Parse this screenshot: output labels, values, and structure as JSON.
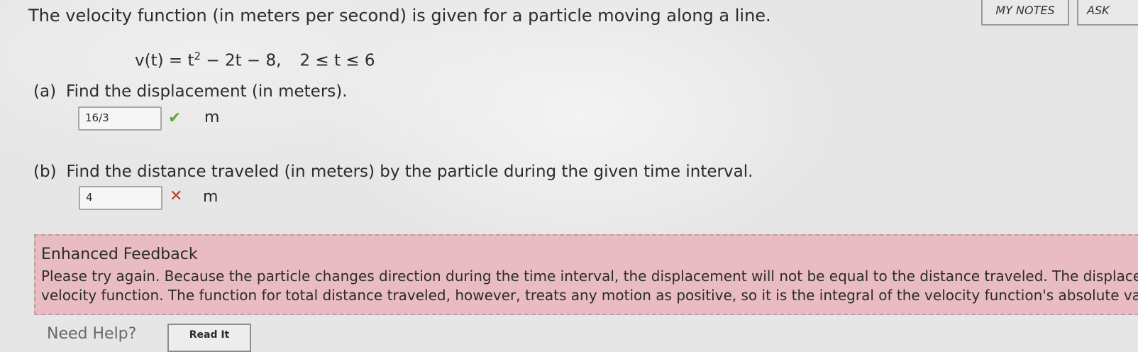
{
  "header": {
    "my_notes_label": "MY NOTES",
    "ask_label": "ASK"
  },
  "question": {
    "text": "The velocity function (in meters per second) is given for a particle moving along a line.",
    "equation_lhs": "v(t) = t",
    "equation_exp": "2",
    "equation_rest": " − 2t − 8,",
    "equation_domain": "2 ≤ t ≤ 6"
  },
  "part_a": {
    "label": "(a)",
    "prompt": "Find the displacement (in meters).",
    "answer": "16/3",
    "status_icon": "check-icon",
    "unit": "m"
  },
  "part_b": {
    "label": "(b)",
    "prompt": "Find the distance traveled (in meters) by the particle during the given time interval.",
    "answer": "4",
    "status_icon": "cross-icon",
    "unit": "m"
  },
  "feedback": {
    "title": "Enhanced Feedback",
    "line1": "Please try again. Because the particle changes direction during the time interval, the displacement will not be equal to the distance traveled. The displacem",
    "line2": "velocity function. The function for total distance traveled, however, treats any motion as positive, so it is the integral of the velocity function's absolute val"
  },
  "help": {
    "label": "Need Help?",
    "read_it_label": "Read It"
  },
  "colors": {
    "feedback_bg": "#e8bcc2",
    "check": "#5aa83a",
    "cross": "#c0392b"
  }
}
